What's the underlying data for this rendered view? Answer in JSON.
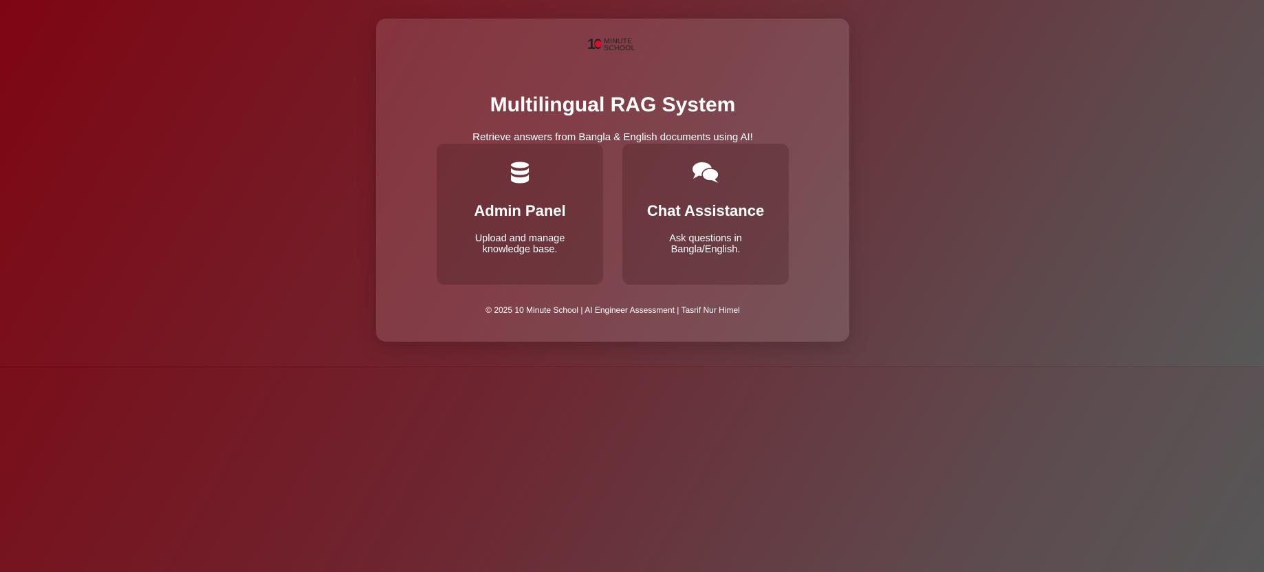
{
  "brand": {
    "logo_number": "10",
    "logo_word_top": "MINUTE",
    "logo_word_bottom": "SCHOOL",
    "accent_color": "#d7102a"
  },
  "header": {
    "title": "Multilingual RAG System",
    "subtitle": "Retrieve answers from Bangla & English documents using AI!"
  },
  "cards": [
    {
      "icon": "database-icon",
      "title": "Admin Panel",
      "description": "Upload and manage knowledge base."
    },
    {
      "icon": "comments-icon",
      "title": "Chat Assistance",
      "description": "Ask questions in Bangla/English."
    }
  ],
  "footer": {
    "text": "© 2025 10 Minute School | AI Engineer Assessment | Tasrif Nur Himel"
  }
}
